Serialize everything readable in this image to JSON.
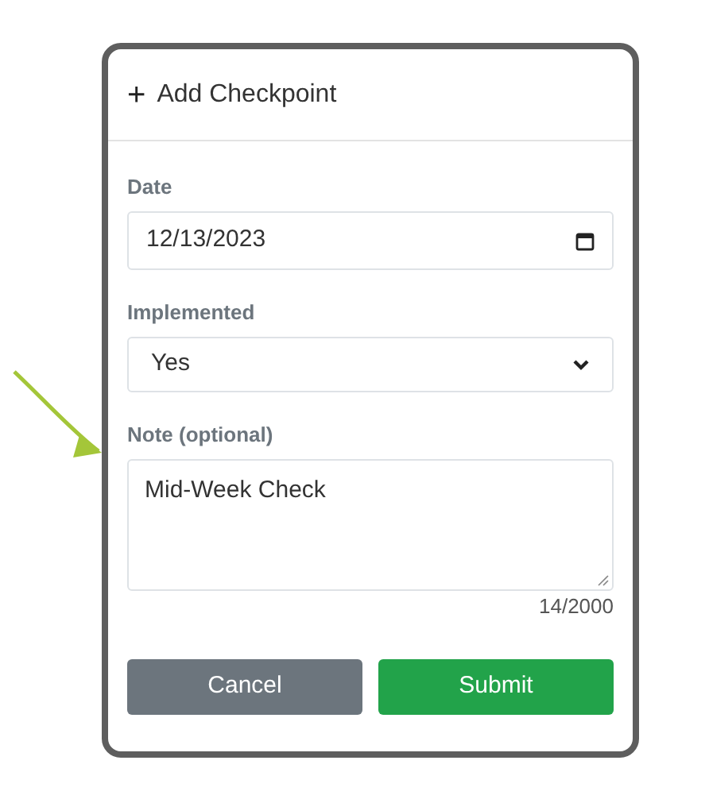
{
  "dialog": {
    "title_icon": "+",
    "title": "Add Checkpoint"
  },
  "fields": [
    {
      "kind": "date",
      "label": "Date",
      "value": "12/13/2023"
    },
    {
      "kind": "select",
      "label": "Implemented",
      "value": "Yes"
    },
    {
      "kind": "textarea",
      "label": "Note (optional)",
      "value": "Mid-Week Check",
      "counter": "14/2000",
      "highlighted": true
    }
  ],
  "buttons": [
    {
      "kind": "secondary",
      "label": "Cancel"
    },
    {
      "kind": "primary",
      "label": "Submit"
    }
  ]
}
